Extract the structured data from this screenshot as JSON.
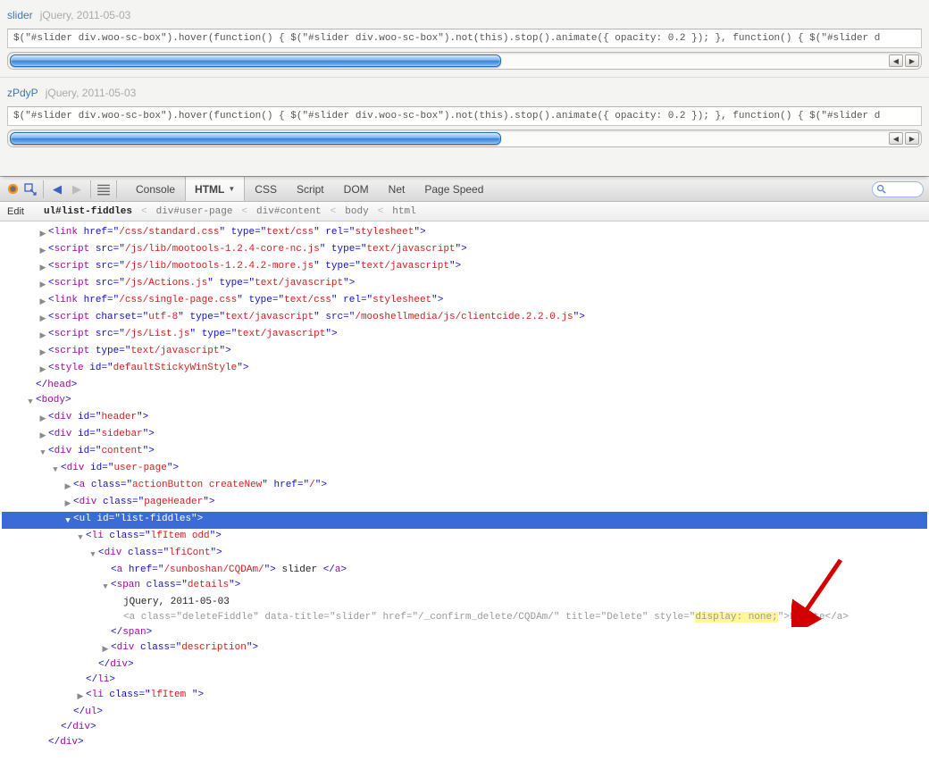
{
  "preview": {
    "items": [
      {
        "name": "slider",
        "meta": "jQuery, 2011-05-03",
        "code": "$(\"#slider div.woo-sc-box\").hover(function() { $(\"#slider div.woo-sc-box\").not(this).stop().animate({ opacity: 0.2 }); }, function() { $(\"#slider d"
      },
      {
        "name": "zPdyP",
        "meta": "jQuery, 2011-05-03",
        "code": "$(\"#slider div.woo-sc-box\").hover(function() { $(\"#slider div.woo-sc-box\").not(this).stop().animate({ opacity: 0.2 }); }, function() { $(\"#slider d"
      }
    ]
  },
  "firebug": {
    "tabs": {
      "console": "Console",
      "html": "HTML",
      "css": "CSS",
      "script": "Script",
      "dom": "DOM",
      "net": "Net",
      "pagespeed": "Page Speed"
    },
    "subbar": {
      "edit": "Edit",
      "crumbs": [
        "ul#list-fiddles",
        "div#user-page",
        "div#content",
        "body",
        "html"
      ]
    }
  },
  "tree": {
    "l01": {
      "indent": "in1",
      "tw": "▶",
      "html": "<link href=\"/css/standard.css\" type=\"text/css\" rel=\"stylesheet\">"
    },
    "l02": {
      "indent": "in1",
      "tw": "▶",
      "html": "<script src=\"/js/lib/mootools-1.2.4-core-nc.js\" type=\"text/javascript\">"
    },
    "l03": {
      "indent": "in1",
      "tw": "▶",
      "html": "<script src=\"/js/lib/mootools-1.2.4.2-more.js\" type=\"text/javascript\">"
    },
    "l04": {
      "indent": "in1",
      "tw": "▶",
      "html": "<script src=\"/js/Actions.js\" type=\"text/javascript\">"
    },
    "l05": {
      "indent": "in1",
      "tw": "▶",
      "html": "<link href=\"/css/single-page.css\" type=\"text/css\" rel=\"stylesheet\">"
    },
    "l06": {
      "indent": "in1",
      "tw": "▶",
      "html": "<script charset=\"utf-8\" type=\"text/javascript\" src=\"/mooshellmedia/js/clientcide.2.2.0.js\">"
    },
    "l07": {
      "indent": "in1",
      "tw": "▶",
      "html": "<script src=\"/js/List.js\" type=\"text/javascript\">"
    },
    "l08": {
      "indent": "in1",
      "tw": "▶",
      "html": "<script type=\"text/javascript\">"
    },
    "l09": {
      "indent": "in1",
      "tw": "▶",
      "html": "<style id=\"defaultStickyWinStyle\">"
    },
    "l10": {
      "indent": "in0",
      "tw": "",
      "close": "</head>"
    },
    "l11": {
      "indent": "in0",
      "tw": "▼",
      "html": "<body>"
    },
    "l12": {
      "indent": "in1",
      "tw": "▶",
      "html": "<div id=\"header\">"
    },
    "l13": {
      "indent": "in1",
      "tw": "▶",
      "html": "<div id=\"sidebar\">"
    },
    "l14": {
      "indent": "in1",
      "tw": "▼",
      "html": "<div id=\"content\">"
    },
    "l15": {
      "indent": "in2",
      "tw": "▼",
      "html": "<div id=\"user-page\">"
    },
    "l16": {
      "indent": "in3",
      "tw": "▶",
      "html": "<a class=\"actionButton createNew\" href=\"/\">"
    },
    "l17": {
      "indent": "in3",
      "tw": "▶",
      "html": "<div class=\"pageHeader\">"
    },
    "l18": {
      "indent": "in3",
      "tw": "▼",
      "html": "<ul id=\"list-fiddles\">",
      "sel": true
    },
    "l19": {
      "indent": "in4",
      "tw": "▼",
      "html": "<li class=\"lfItem odd\">"
    },
    "l20": {
      "indent": "in5",
      "tw": "▼",
      "html": "<div class=\"lfiCont\">"
    },
    "l21_pre": {
      "indent": "in6",
      "html_open": "<a href=\"/sunboshan/CQDAm/\">",
      "text": " slider ",
      "html_close": "</a>"
    },
    "l22": {
      "indent": "in6",
      "tw": "▼",
      "html": "<span class=\"details\">"
    },
    "l23_text": {
      "indent": "in7",
      "plain": "jQuery, 2011-05-03"
    },
    "l24": {
      "indent": "in7",
      "dim_open": "<a class=\"deleteFiddle\" data-title=\"slider\" href=\"/_confirm_delete/CQDAm/\" title=\"Delete\" style=\"",
      "highlight": "display: none;",
      "dim_after": "\">",
      "dim_text": "Delete",
      "dim_close": "</a>"
    },
    "l25": {
      "indent": "in6",
      "close": "</span>"
    },
    "l26": {
      "indent": "in6",
      "tw": "▶",
      "html": "<div class=\"description\">"
    },
    "l27": {
      "indent": "in5",
      "close": "</div>"
    },
    "l28": {
      "indent": "in4",
      "close": "</li>"
    },
    "l29": {
      "indent": "in4",
      "tw": "▶",
      "html": "<li class=\"lfItem \">"
    },
    "l30": {
      "indent": "in3",
      "close": "</ul>"
    },
    "l31": {
      "indent": "in2",
      "close": "</div>"
    },
    "l32": {
      "indent": "in1",
      "close": "</div>"
    }
  }
}
